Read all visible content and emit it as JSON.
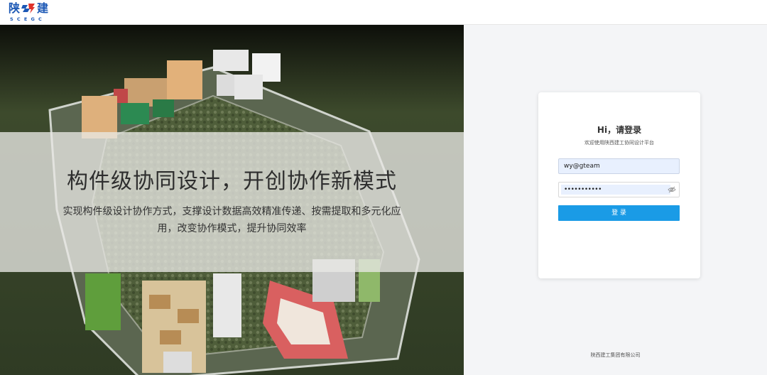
{
  "brand": {
    "name_left": "陕",
    "name_right": "建",
    "sub": "SCEGC",
    "color": "#1c58b5"
  },
  "hero": {
    "title": "构件级协同设计，开创协作新模式",
    "description": "实现构件级设计协作方式，支撑设计数据高效精准传递、按需提取和多元化应用，改变协作模式，提升协同效率"
  },
  "login": {
    "title": "Hi，请登录",
    "subtitle": "欢迎使用陕西建工协同设计平台",
    "username_value": "wy@gteam",
    "password_mask": "•••••••••••",
    "submit_label": "登 录",
    "accent": "#1a9be6"
  },
  "footer": {
    "company": "陕西建工集团有限公司"
  }
}
